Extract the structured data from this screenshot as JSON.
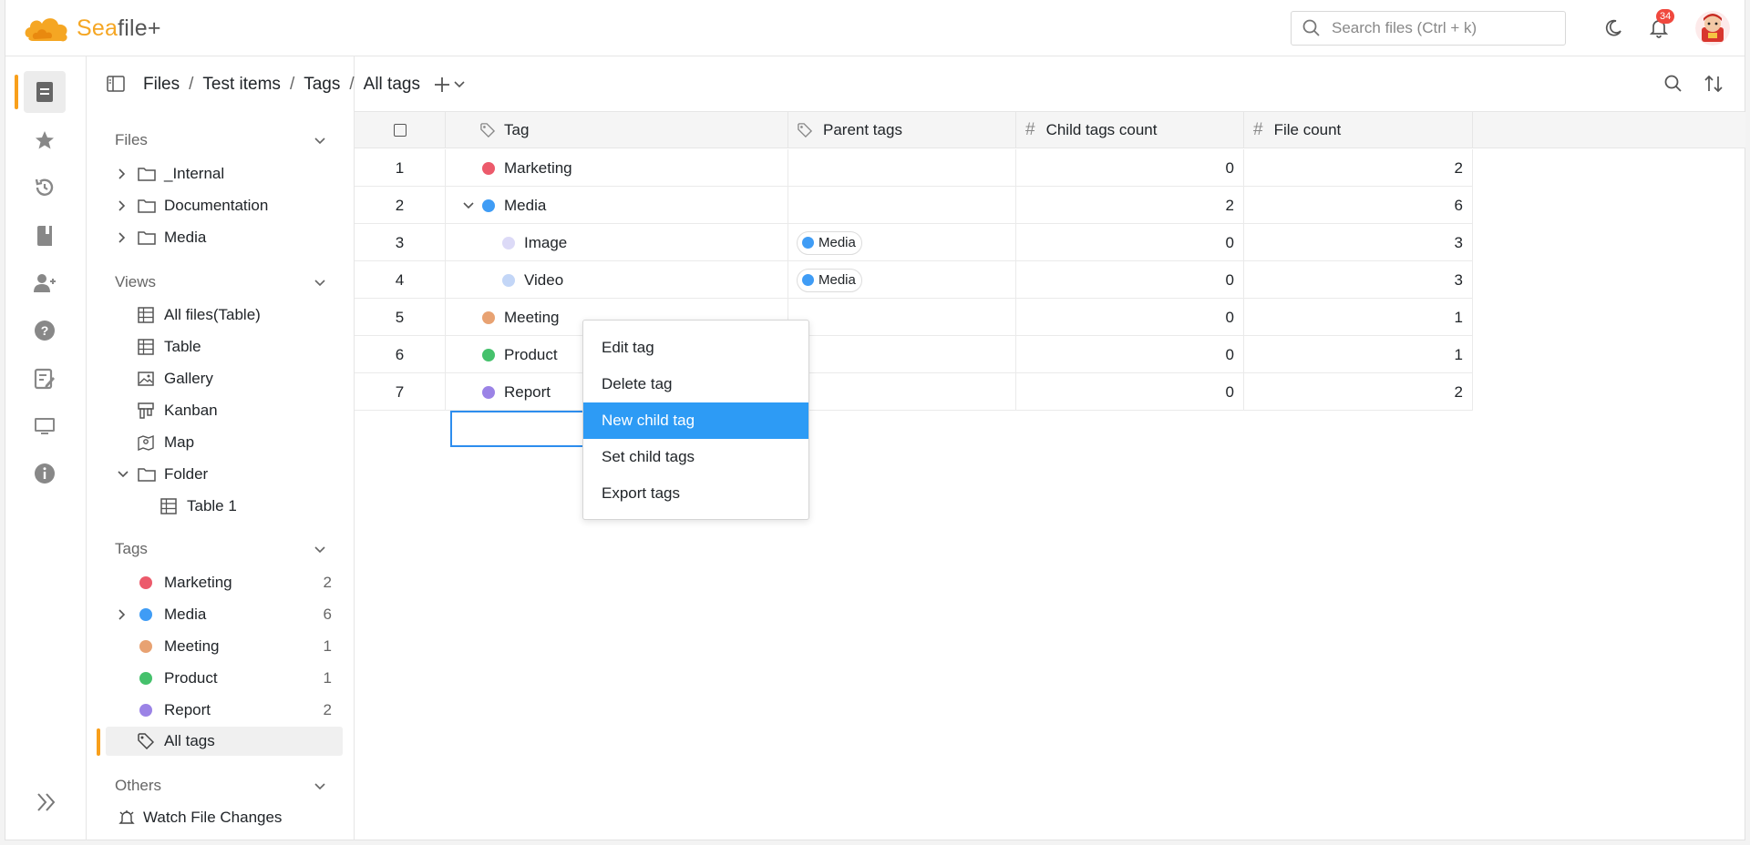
{
  "app": {
    "logo_text_a": "Sea",
    "logo_text_b": "file+",
    "search_placeholder": "Search files (Ctrl + k)",
    "notification_count": "34"
  },
  "breadcrumb": [
    "Files",
    "Test items",
    "Tags",
    "All tags"
  ],
  "sidebar": {
    "files_title": "Files",
    "files": [
      "_Internal",
      "Documentation",
      "Media"
    ],
    "views_title": "Views",
    "views": [
      {
        "label": "All files(Table)",
        "icon": "table-icon"
      },
      {
        "label": "Table",
        "icon": "table-icon"
      },
      {
        "label": "Gallery",
        "icon": "image-icon"
      },
      {
        "label": "Kanban",
        "icon": "kanban-icon"
      },
      {
        "label": "Map",
        "icon": "map-icon"
      },
      {
        "label": "Folder",
        "icon": "folder-icon"
      },
      {
        "label": "Table 1",
        "icon": "table-icon"
      }
    ],
    "tags_title": "Tags",
    "tags": [
      {
        "label": "Marketing",
        "count": "2",
        "color": "#ec5a6b"
      },
      {
        "label": "Media",
        "count": "6",
        "color": "#3f9cf5"
      },
      {
        "label": "Meeting",
        "count": "1",
        "color": "#e8a272"
      },
      {
        "label": "Product",
        "count": "1",
        "color": "#45c16c"
      },
      {
        "label": "Report",
        "count": "2",
        "color": "#9b83e6"
      }
    ],
    "all_tags": "All tags",
    "others_title": "Others",
    "watch": "Watch File Changes"
  },
  "table": {
    "columns": [
      "Tag",
      "Parent tags",
      "Child tags count",
      "File count"
    ],
    "rows": [
      {
        "idx": "1",
        "tag": "Marketing",
        "color": "#ec5a6b",
        "parent": "",
        "child": "0",
        "files": "2"
      },
      {
        "idx": "2",
        "tag": "Media",
        "color": "#3f9cf5",
        "parent": "",
        "child": "2",
        "files": "6"
      },
      {
        "idx": "3",
        "tag": "Image",
        "color": "#dcdaf7",
        "parent": "Media",
        "child": "0",
        "files": "3"
      },
      {
        "idx": "4",
        "tag": "Video",
        "color": "#c3d6f7",
        "parent": "Media",
        "child": "0",
        "files": "3"
      },
      {
        "idx": "5",
        "tag": "Meeting",
        "color": "#e8a272",
        "parent": "",
        "child": "0",
        "files": "1"
      },
      {
        "idx": "6",
        "tag": "Product",
        "color": "#45c16c",
        "parent": "",
        "child": "0",
        "files": "1"
      },
      {
        "idx": "7",
        "tag": "Report",
        "color": "#9b83e6",
        "parent": "",
        "child": "0",
        "files": "2"
      }
    ],
    "parent_chip_color": "#3f9cf5"
  },
  "context_menu": [
    "Edit tag",
    "Delete tag",
    "New child tag",
    "Set child tags",
    "Export tags"
  ]
}
